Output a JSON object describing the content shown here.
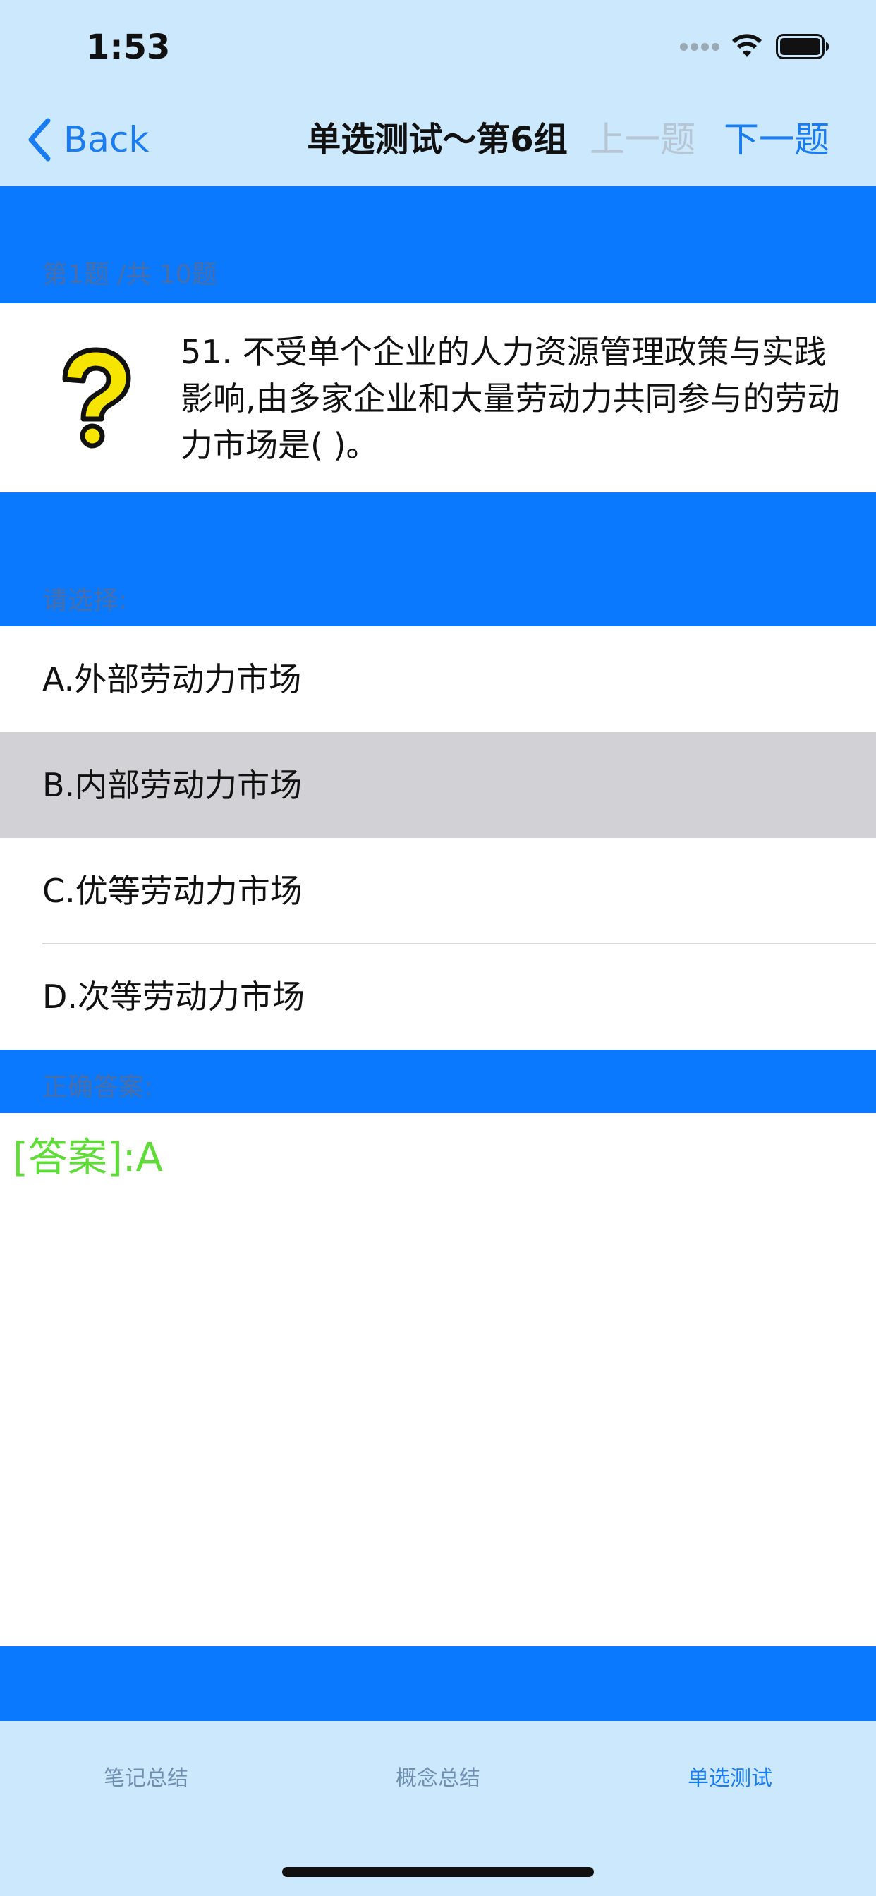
{
  "status_bar": {
    "time": "1:53"
  },
  "nav": {
    "back_label": "Back",
    "title": "单选测试～第6组",
    "prev_label": "上一题",
    "next_label": "下一题"
  },
  "question": {
    "progress": "第1题 /共 10题",
    "text": "51. 不受单个企业的人力资源管理政策与实践影响,由多家企业和大量劳动力共同参与的劳动力市场是( )。"
  },
  "choices": {
    "prompt": "请选择:",
    "options": [
      {
        "label": "A.外部劳动力市场"
      },
      {
        "label": "B.内部劳动力市场"
      },
      {
        "label": "C.优等劳动力市场"
      },
      {
        "label": "D.次等劳动力市场"
      }
    ]
  },
  "answer": {
    "heading": "正确答案:",
    "text": "[答案]:A"
  },
  "tabs": [
    {
      "label": "笔记总结"
    },
    {
      "label": "概念总结"
    },
    {
      "label": "单选测试"
    }
  ],
  "colors": {
    "nav_background": "#cbe8fc",
    "band_blue": "#0a79fd",
    "accent": "#1a7cf2",
    "answer_green": "#5fdc37",
    "selected_row": "#d2d2d6"
  }
}
